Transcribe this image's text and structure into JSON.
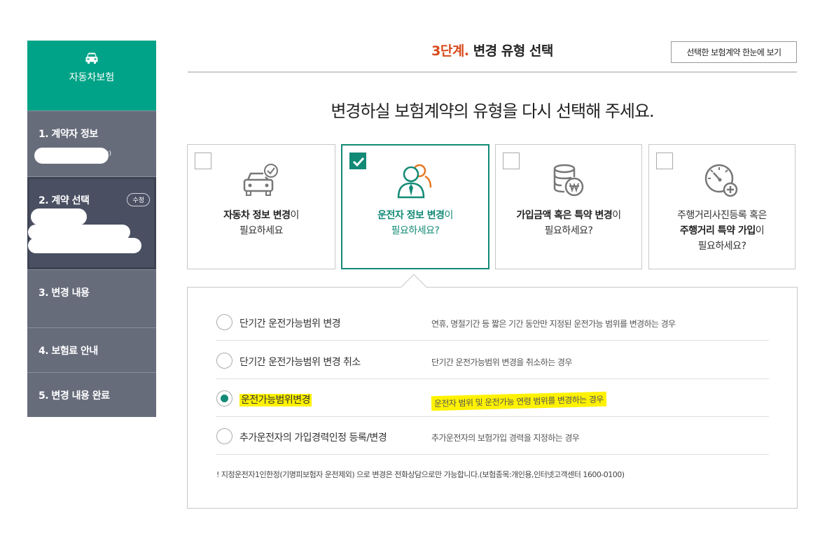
{
  "sidebar": {
    "top_label": "자동차보험",
    "items": [
      {
        "label": "1. 계약자 정보"
      },
      {
        "label": "2. 계약 선택",
        "badge": "수정"
      },
      {
        "label": "3. 변경 내용"
      },
      {
        "label": "4. 보험료 안내"
      },
      {
        "label": "5. 변경 내용 완료"
      }
    ],
    "masked_suffix": "*)"
  },
  "header": {
    "step_num": "3단계.",
    "step_title": "변경 유형 선택",
    "summary_button": "선택한 보험계약 한눈에 보기",
    "question": "변경하실 보험계약의 유형을 다시 선택해 주세요."
  },
  "cards": [
    {
      "bold": "자동차 정보 변경",
      "suffix": "이",
      "line2": "필요하세요",
      "selected": false
    },
    {
      "bold": "운전자 정보 변경",
      "suffix": "이",
      "line2": "필요하세요?",
      "selected": true
    },
    {
      "bold": "가입금액 혹은 특약 변경",
      "suffix": "이",
      "line2": "필요하세요?",
      "selected": false
    },
    {
      "line0": "주행거리사진등록 혹은",
      "bold": "주행거리 특약 가입",
      "suffix": "이",
      "line2": "필요하세요?",
      "selected": false
    }
  ],
  "options": [
    {
      "label": "단기간 운전가능범위 변경",
      "desc": "연휴, 명절기간 등 짧은 기간 동안만 지정된 운전가능 범위를 변경하는 경우",
      "selected": false
    },
    {
      "label": "단기간 운전가능범위 변경 취소",
      "desc": "단기간 운전가능범위 변경을 취소하는 경우",
      "selected": false
    },
    {
      "label": "운전가능범위변경",
      "desc": "운전자 범위 및 운전가능 연령 범위를 변경하는 경우",
      "selected": true
    },
    {
      "label": "추가운전자의 가입경력인정 등록/변경",
      "desc": "추가운전자의 보험가입 경력을 지정하는 경우",
      "selected": false
    }
  ],
  "note": "! 지정운전자1인한정(기명피보험자 운전제외) 으로 변경은 전화상담으로만 가능합니다.(보험종목:개인용,인터넷고객센터 1600-0100)",
  "colors": {
    "accent": "#00a387",
    "selected": "#128a76",
    "step_num": "#d84a1b",
    "sidebar": "#676c7b",
    "highlight": "#fff200"
  }
}
